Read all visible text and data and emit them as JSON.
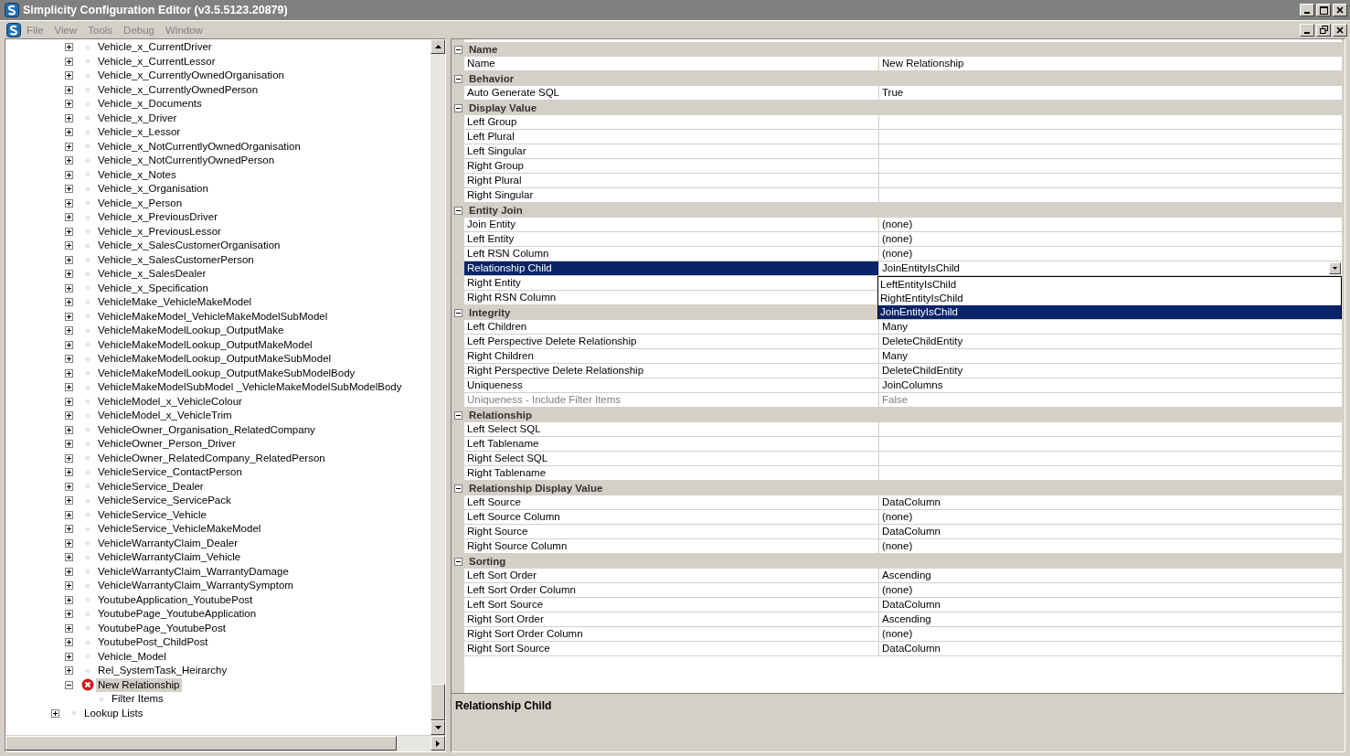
{
  "window": {
    "title": "Simplicity Configuration Editor (v3.5.5123.20879)"
  },
  "menu": [
    {
      "label": "File",
      "disabled": true
    },
    {
      "label": "View",
      "disabled": true
    },
    {
      "label": "Tools",
      "disabled": true
    },
    {
      "label": "Debug",
      "disabled": true
    },
    {
      "label": "Window",
      "disabled": true
    }
  ],
  "tree": [
    {
      "children": [
        {
          "label": "Vehicle_x_CurrentDriver",
          "expanded": false,
          "selected": false,
          "error": false
        },
        {
          "label": "Vehicle_x_CurrentLessor",
          "expanded": false,
          "selected": false,
          "error": false
        },
        {
          "label": "Vehicle_x_CurrentlyOwnedOrganisation",
          "expanded": false,
          "selected": false,
          "error": false
        },
        {
          "label": "Vehicle_x_CurrentlyOwnedPerson",
          "expanded": false,
          "selected": false,
          "error": false
        },
        {
          "label": "Vehicle_x_Documents",
          "expanded": false,
          "selected": false,
          "error": false
        },
        {
          "label": "Vehicle_x_Driver",
          "expanded": false,
          "selected": false,
          "error": false
        },
        {
          "label": "Vehicle_x_Lessor",
          "expanded": false,
          "selected": false,
          "error": false
        },
        {
          "label": "Vehicle_x_NotCurrentlyOwnedOrganisation",
          "expanded": false,
          "selected": false,
          "error": false
        },
        {
          "label": "Vehicle_x_NotCurrentlyOwnedPerson",
          "expanded": false,
          "selected": false,
          "error": false
        },
        {
          "label": "Vehicle_x_Notes",
          "expanded": false,
          "selected": false,
          "error": false
        },
        {
          "label": "Vehicle_x_Organisation",
          "expanded": false,
          "selected": false,
          "error": false
        },
        {
          "label": "Vehicle_x_Person",
          "expanded": false,
          "selected": false,
          "error": false
        },
        {
          "label": "Vehicle_x_PreviousDriver",
          "expanded": false,
          "selected": false,
          "error": false
        },
        {
          "label": "Vehicle_x_PreviousLessor",
          "expanded": false,
          "selected": false,
          "error": false
        },
        {
          "label": "Vehicle_x_SalesCustomerOrganisation",
          "expanded": false,
          "selected": false,
          "error": false
        },
        {
          "label": "Vehicle_x_SalesCustomerPerson",
          "expanded": false,
          "selected": false,
          "error": false
        },
        {
          "label": "Vehicle_x_SalesDealer",
          "expanded": false,
          "selected": false,
          "error": false
        },
        {
          "label": "Vehicle_x_Specification",
          "expanded": false,
          "selected": false,
          "error": false
        },
        {
          "label": "VehicleMake_VehicleMakeModel",
          "expanded": false,
          "selected": false,
          "error": false
        },
        {
          "label": "VehicleMakeModel_VehicleMakeModelSubModel",
          "expanded": false,
          "selected": false,
          "error": false
        },
        {
          "label": "VehicleMakeModelLookup_OutputMake",
          "expanded": false,
          "selected": false,
          "error": false
        },
        {
          "label": "VehicleMakeModelLookup_OutputMakeModel",
          "expanded": false,
          "selected": false,
          "error": false
        },
        {
          "label": "VehicleMakeModelLookup_OutputMakeSubModel",
          "expanded": false,
          "selected": false,
          "error": false
        },
        {
          "label": "VehicleMakeModelLookup_OutputMakeSubModelBody",
          "expanded": false,
          "selected": false,
          "error": false
        },
        {
          "label": "VehicleMakeModelSubModel _VehicleMakeModelSubModelBody",
          "expanded": false,
          "selected": false,
          "error": false
        },
        {
          "label": "VehicleModel_x_VehicleColour",
          "expanded": false,
          "selected": false,
          "error": false
        },
        {
          "label": "VehicleModel_x_VehicleTrim",
          "expanded": false,
          "selected": false,
          "error": false
        },
        {
          "label": "VehicleOwner_Organisation_RelatedCompany",
          "expanded": false,
          "selected": false,
          "error": false
        },
        {
          "label": "VehicleOwner_Person_Driver",
          "expanded": false,
          "selected": false,
          "error": false
        },
        {
          "label": "VehicleOwner_RelatedCompany_RelatedPerson",
          "expanded": false,
          "selected": false,
          "error": false
        },
        {
          "label": "VehicleService_ContactPerson",
          "expanded": false,
          "selected": false,
          "error": false
        },
        {
          "label": "VehicleService_Dealer",
          "expanded": false,
          "selected": false,
          "error": false
        },
        {
          "label": "VehicleService_ServicePack",
          "expanded": false,
          "selected": false,
          "error": false
        },
        {
          "label": "VehicleService_Vehicle",
          "expanded": false,
          "selected": false,
          "error": false
        },
        {
          "label": "VehicleService_VehicleMakeModel",
          "expanded": false,
          "selected": false,
          "error": false
        },
        {
          "label": "VehicleWarrantyClaim_Dealer",
          "expanded": false,
          "selected": false,
          "error": false
        },
        {
          "label": "VehicleWarrantyClaim_Vehicle",
          "expanded": false,
          "selected": false,
          "error": false
        },
        {
          "label": "VehicleWarrantyClaim_WarrantyDamage",
          "expanded": false,
          "selected": false,
          "error": false
        },
        {
          "label": "VehicleWarrantyClaim_WarrantySymptom",
          "expanded": false,
          "selected": false,
          "error": false
        },
        {
          "label": "YoutubeApplication_YoutubePost",
          "expanded": false,
          "selected": false,
          "error": false
        },
        {
          "label": "YoutubePage_YoutubeApplication",
          "expanded": false,
          "selected": false,
          "error": false
        },
        {
          "label": "YoutubePage_YoutubePost",
          "expanded": false,
          "selected": false,
          "error": false
        },
        {
          "label": "YoutubePost_ChildPost",
          "expanded": false,
          "selected": false,
          "error": false
        },
        {
          "label": "Vehicle_Model",
          "expanded": false,
          "selected": false,
          "error": false
        },
        {
          "label": "Rel_SystemTask_Heirarchy",
          "expanded": false,
          "selected": false,
          "error": false
        },
        {
          "label": "New Relationship",
          "expanded": true,
          "selected": true,
          "error": true,
          "children": [
            {
              "label": "Filter Items"
            }
          ]
        }
      ]
    },
    {
      "label": "Lookup Lists",
      "expanded": false,
      "selected": false,
      "error": false
    }
  ],
  "properties": [
    {
      "category": "Name",
      "rows": [
        {
          "name": "Name",
          "value": "New Relationship",
          "selected": false,
          "disabled": false
        }
      ]
    },
    {
      "category": "Behavior",
      "rows": [
        {
          "name": "Auto Generate SQL",
          "value": "True",
          "selected": false,
          "disabled": false
        }
      ]
    },
    {
      "category": "Display Value",
      "rows": [
        {
          "name": "Left Group",
          "selected": false,
          "disabled": false
        },
        {
          "name": "Left Plural",
          "selected": false,
          "disabled": false
        },
        {
          "name": "Left Singular",
          "selected": false,
          "disabled": false
        },
        {
          "name": "Right Group",
          "selected": false,
          "disabled": false
        },
        {
          "name": "Right Plural",
          "selected": false,
          "disabled": false
        },
        {
          "name": "Right Singular",
          "selected": false,
          "disabled": false
        }
      ]
    },
    {
      "category": "Entity Join",
      "rows": [
        {
          "name": "Join Entity",
          "value": "(none)",
          "selected": false,
          "disabled": false
        },
        {
          "name": "Left Entity",
          "value": "(none)",
          "selected": false,
          "disabled": false
        },
        {
          "name": "Left RSN Column",
          "value": "(none)",
          "selected": false,
          "disabled": false
        },
        {
          "name": "Relationship Child",
          "value": "JoinEntityIsChild",
          "selected": true,
          "disabled": false,
          "dropdown": {
            "options": [
              {
                "label": "LeftEntityIsChild",
                "selected": false
              },
              {
                "label": "RightEntityIsChild",
                "selected": false
              },
              {
                "label": "JoinEntityIsChild",
                "selected": true
              }
            ]
          }
        },
        {
          "name": "Right Entity",
          "selected": false,
          "disabled": false
        },
        {
          "name": "Right RSN Column",
          "selected": false,
          "disabled": false
        }
      ]
    },
    {
      "category": "Integrity",
      "rows": [
        {
          "name": "Left Children",
          "value": "Many",
          "selected": false,
          "disabled": false
        },
        {
          "name": "Left Perspective Delete Relationship",
          "value": "DeleteChildEntity",
          "selected": false,
          "disabled": false
        },
        {
          "name": "Right Children",
          "value": "Many",
          "selected": false,
          "disabled": false
        },
        {
          "name": "Right Perspective Delete Relationship",
          "value": "DeleteChildEntity",
          "selected": false,
          "disabled": false
        },
        {
          "name": "Uniqueness",
          "value": "JoinColumns",
          "selected": false,
          "disabled": false
        },
        {
          "name": "Uniqueness - Include Filter Items",
          "value": "False",
          "selected": false,
          "disabled": true
        }
      ]
    },
    {
      "category": "Relationship",
      "rows": [
        {
          "name": "Left Select SQL",
          "selected": false,
          "disabled": false
        },
        {
          "name": "Left Tablename",
          "selected": false,
          "disabled": false
        },
        {
          "name": "Right Select SQL",
          "selected": false,
          "disabled": false
        },
        {
          "name": "Right Tablename",
          "selected": false,
          "disabled": false
        }
      ]
    },
    {
      "category": "Relationship Display Value",
      "rows": [
        {
          "name": "Left Source",
          "value": "DataColumn",
          "selected": false,
          "disabled": false
        },
        {
          "name": "Left Source Column",
          "value": "(none)",
          "selected": false,
          "disabled": false
        },
        {
          "name": "Right Source",
          "value": "DataColumn",
          "selected": false,
          "disabled": false
        },
        {
          "name": "Right Source Column",
          "value": "(none)",
          "selected": false,
          "disabled": false
        }
      ]
    },
    {
      "category": "Sorting",
      "rows": [
        {
          "name": "Left Sort Order",
          "value": "Ascending",
          "selected": false,
          "disabled": false
        },
        {
          "name": "Left Sort Order Column",
          "value": "(none)",
          "selected": false,
          "disabled": false
        },
        {
          "name": "Left Sort Source",
          "value": "DataColumn",
          "selected": false,
          "disabled": false
        },
        {
          "name": "Right Sort Order",
          "value": "Ascending",
          "selected": false,
          "disabled": false
        },
        {
          "name": "Right Sort Order Column",
          "value": "(none)",
          "selected": false,
          "disabled": false
        },
        {
          "name": "Right Sort Source",
          "value": "DataColumn",
          "selected": false,
          "disabled": false
        }
      ]
    }
  ],
  "description": {
    "title": "Relationship Child"
  }
}
